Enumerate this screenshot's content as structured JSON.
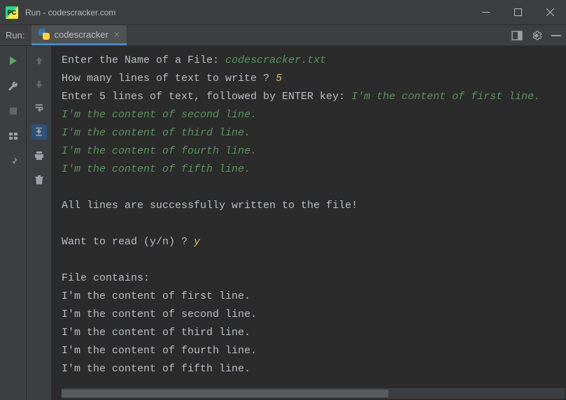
{
  "window": {
    "title": "Run - codescracker.com"
  },
  "toolbar": {
    "run_label": "Run:",
    "tab_name": "codescracker"
  },
  "console": {
    "lines": [
      {
        "prompt": "Enter the Name of a File: ",
        "input": "codescracker.txt",
        "style": "user"
      },
      {
        "prompt": "How many lines of text to write ? ",
        "input": "5",
        "style": "num"
      },
      {
        "prompt": "Enter 5 lines of text, followed by ENTER key: ",
        "input": "I'm the content of first line.",
        "style": "user"
      },
      {
        "prompt": "",
        "input": "I'm the content of second line.",
        "style": "user"
      },
      {
        "prompt": "",
        "input": "I'm the content of third line.",
        "style": "user"
      },
      {
        "prompt": "",
        "input": "I'm the content of fourth line.",
        "style": "user"
      },
      {
        "prompt": "",
        "input": "I'm the content of fifth line.",
        "style": "user"
      },
      {
        "prompt": "",
        "input": ""
      },
      {
        "prompt": "All lines are successfully written to the file!",
        "input": ""
      },
      {
        "prompt": "",
        "input": ""
      },
      {
        "prompt": "Want to read (y/n) ? ",
        "input": "y",
        "style": "num"
      },
      {
        "prompt": "",
        "input": ""
      },
      {
        "prompt": "File contains:",
        "input": ""
      },
      {
        "prompt": "I'm the content of first line.",
        "input": ""
      },
      {
        "prompt": "I'm the content of second line.",
        "input": ""
      },
      {
        "prompt": "I'm the content of third line.",
        "input": ""
      },
      {
        "prompt": "I'm the content of fourth line.",
        "input": ""
      },
      {
        "prompt": "I'm the content of fifth line.",
        "input": ""
      }
    ]
  }
}
